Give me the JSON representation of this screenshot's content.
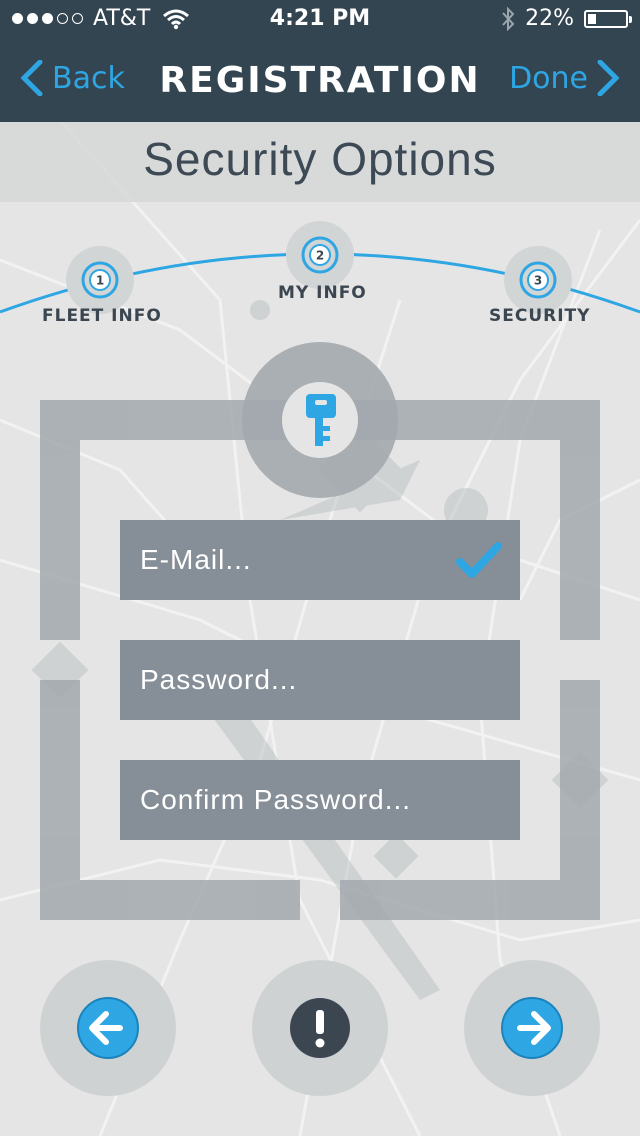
{
  "status_bar": {
    "carrier": "AT&T",
    "signal_bars_filled": 3,
    "signal_bars_total": 5,
    "time": "4:21 PM",
    "battery_percent": "22%",
    "battery_level": 0.22
  },
  "nav": {
    "back_label": "Back",
    "title": "REGISTRATION",
    "done_label": "Done"
  },
  "page_title": "Security Options",
  "steps": [
    {
      "number": "1",
      "label": "FLEET INFO"
    },
    {
      "number": "2",
      "label": "MY INFO"
    },
    {
      "number": "3",
      "label": "SECURITY"
    }
  ],
  "form": {
    "email_placeholder": "E-Mail...",
    "password_placeholder": "Password...",
    "confirm_placeholder": "Confirm Password..."
  },
  "icons": {
    "key": "key-icon",
    "check": "checkmark-icon",
    "prev": "arrow-left-icon",
    "info": "exclamation-icon",
    "next": "arrow-right-icon"
  },
  "colors": {
    "nav_bg": "#344552",
    "accent": "#2ea6e3",
    "field_bg": "#868e97",
    "frame": "#a3a9ae",
    "title_text": "#3d4a55"
  }
}
